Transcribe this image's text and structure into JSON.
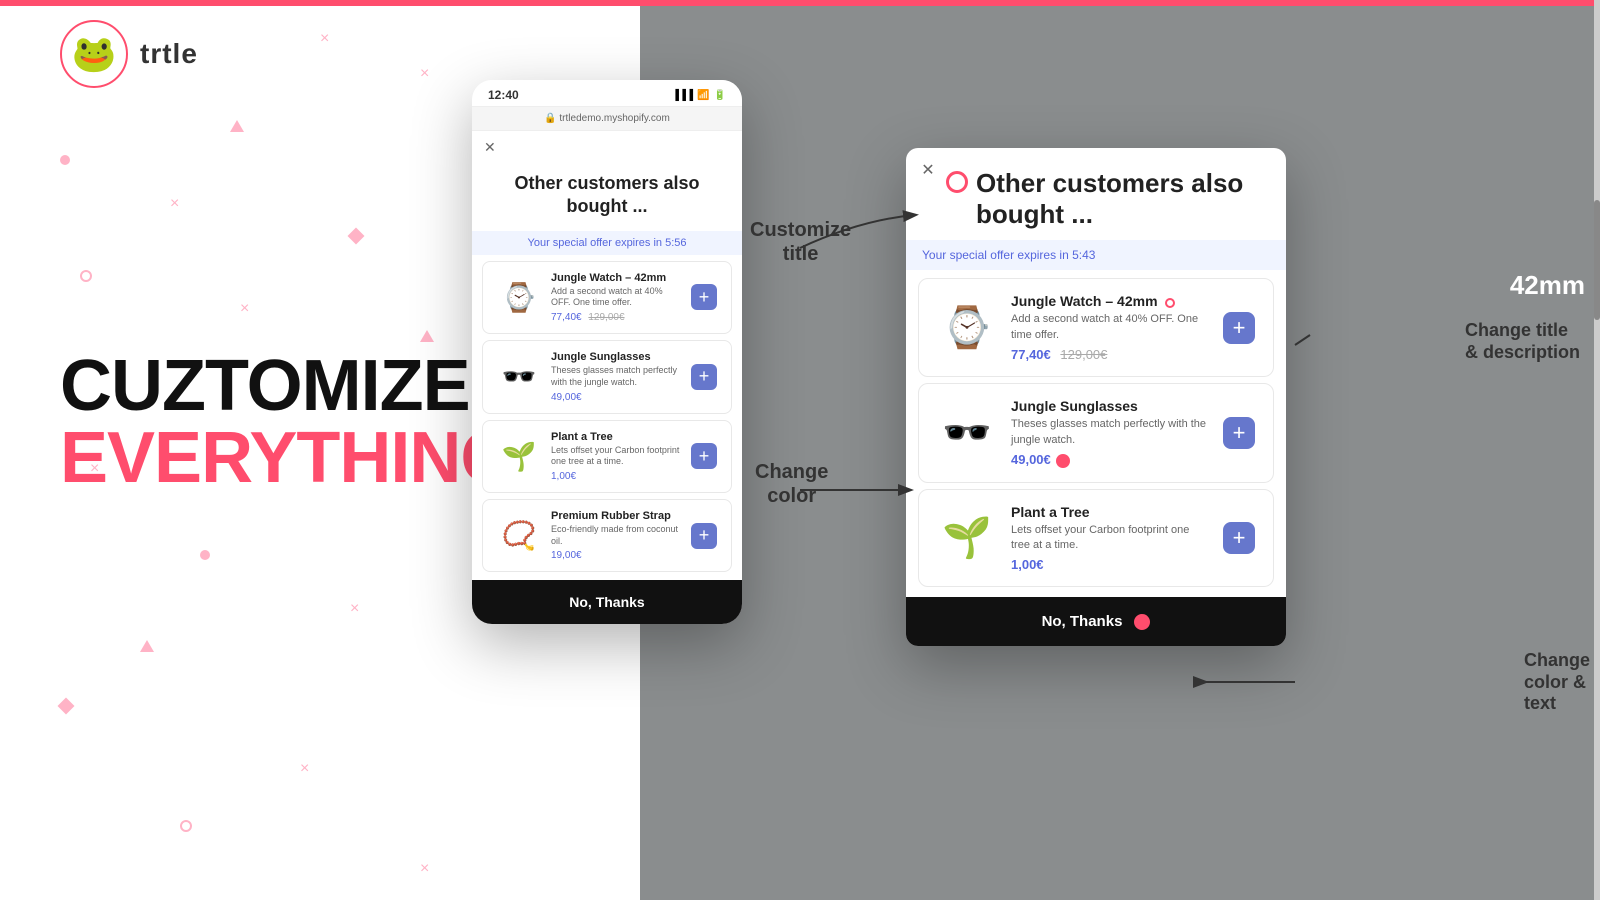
{
  "brand": {
    "name": "trtle",
    "logo_emoji": "🐸"
  },
  "hero": {
    "line1": "CUZTOMIZE",
    "line2": "EVERYTHING"
  },
  "mobile_popup": {
    "status_time": "12:40",
    "browser_url": "trtledemo.myshopify.com",
    "title": "Other customers also bought ...",
    "timer_label": "Your special offer expires in 5:56",
    "products": [
      {
        "name": "Jungle Watch – 42mm",
        "desc": "Add a second watch at 40% OFF. One time offer.",
        "price": "77,40€",
        "old_price": "129,00€",
        "emoji": "⌚"
      },
      {
        "name": "Jungle Sunglasses",
        "desc": "Theses glasses match perfectly with the jungle watch.",
        "price": "49,00€",
        "old_price": "",
        "emoji": "🕶️"
      },
      {
        "name": "Plant a Tree",
        "desc": "Lets offset your Carbon footprint one tree at a time.",
        "price": "1,00€",
        "old_price": "",
        "emoji": "🌱"
      },
      {
        "name": "Premium Rubber Strap",
        "desc": "Eco-friendly made from coconut oil.",
        "price": "19,00€",
        "old_price": "",
        "emoji": "📿"
      }
    ],
    "no_thanks": "No, Thanks"
  },
  "desktop_popup": {
    "title": "Other customers also bought ...",
    "timer_label": "Your special offer expires in 5:43",
    "products": [
      {
        "name": "Jungle Watch – 42mm",
        "desc": "Add a second watch at 40% OFF. One time offer.",
        "price": "77,40€",
        "old_price": "129,00€",
        "emoji": "⌚"
      },
      {
        "name": "Jungle Sunglasses",
        "desc": "Theses glasses match perfectly with the jungle watch.",
        "price": "49,00€",
        "old_price": "",
        "emoji": "🕶️"
      },
      {
        "name": "Plant a Tree",
        "desc": "Lets offset your Carbon footprint one tree at a time.",
        "price": "1,00€",
        "old_price": "",
        "emoji": "🌱"
      }
    ],
    "no_thanks": "No, Thanks"
  },
  "annotations": {
    "customize_title": "Customize\ntitle",
    "change_color": "Change\ncolor",
    "change_title_desc": "Change title\n& description",
    "change_color_text": "Change\ncolor &\ntext",
    "size_label": "42mm"
  }
}
